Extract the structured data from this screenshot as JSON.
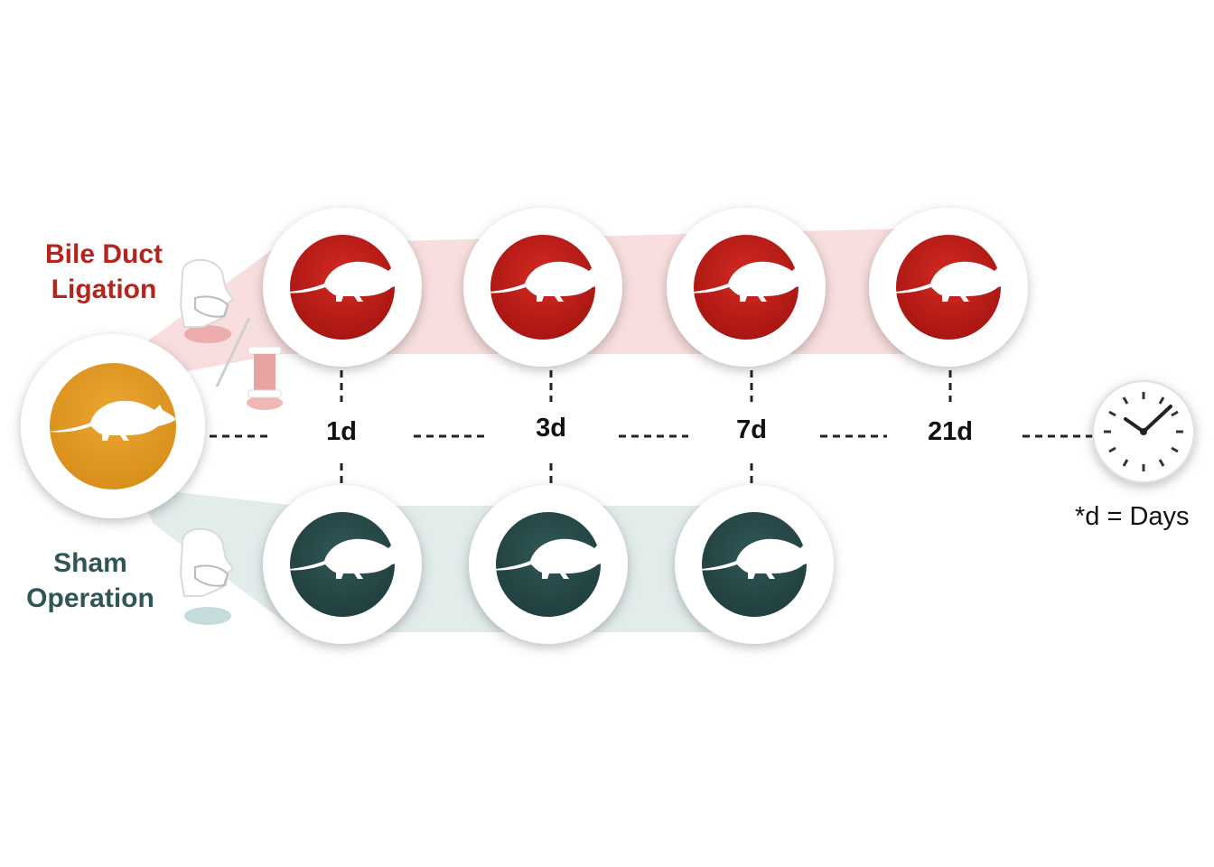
{
  "groups": {
    "bdl": {
      "line1": "Bile Duct",
      "line2": "Ligation",
      "color": "#b5241d",
      "band": "#f8dede"
    },
    "sham": {
      "line1": "Sham",
      "line2": "Operation",
      "color": "#2f5655",
      "band": "#e1eceb"
    }
  },
  "baseline": {
    "color": "#e8a22c",
    "icon": "rat-icon"
  },
  "timepoints": [
    "1d",
    "3d",
    "7d",
    "21d"
  ],
  "bdl_timepoints": [
    "1d",
    "3d",
    "7d",
    "21d"
  ],
  "sham_timepoints": [
    "1d",
    "3d",
    "7d"
  ],
  "legend": "*d = Days",
  "icons": [
    "rat-icon",
    "surgeon-mask-icon",
    "needle-icon",
    "thread-spool-icon",
    "clock-icon"
  ]
}
